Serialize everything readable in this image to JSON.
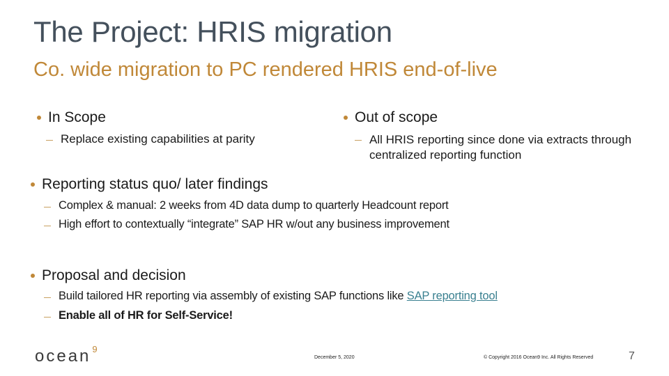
{
  "slide": {
    "title": "The Project: HRIS migration",
    "subtitle": "Co. wide migration to PC rendered HRIS end-of-live"
  },
  "in_scope": {
    "heading": "In Scope",
    "items": [
      "Replace existing capabilities at parity"
    ]
  },
  "out_of_scope": {
    "heading": "Out of scope",
    "items": [
      "All HRIS reporting since done via extracts through centralized reporting function"
    ]
  },
  "reporting": {
    "heading": "Reporting status quo/ later findings",
    "items": [
      "Complex & manual: 2 weeks from 4D data dump to quarterly Headcount report",
      "High effort to contextually “integrate” SAP HR w/out any business improvement"
    ]
  },
  "proposal": {
    "heading": "Proposal and decision",
    "item1_text": "Build tailored HR reporting via assembly of existing SAP functions like ",
    "item1_link": "SAP reporting tool",
    "item2": "Enable all of HR for Self-Service!"
  },
  "footer": {
    "logo_text": "ocean",
    "logo_sup": "9",
    "date": "December 5, 2020",
    "copyright": "© Copyright 2016 Ocean9 Inc. All Rights Reserved",
    "page_number": "7"
  },
  "colors": {
    "title": "#44505c",
    "accent": "#c08838",
    "link": "#3a8090"
  }
}
